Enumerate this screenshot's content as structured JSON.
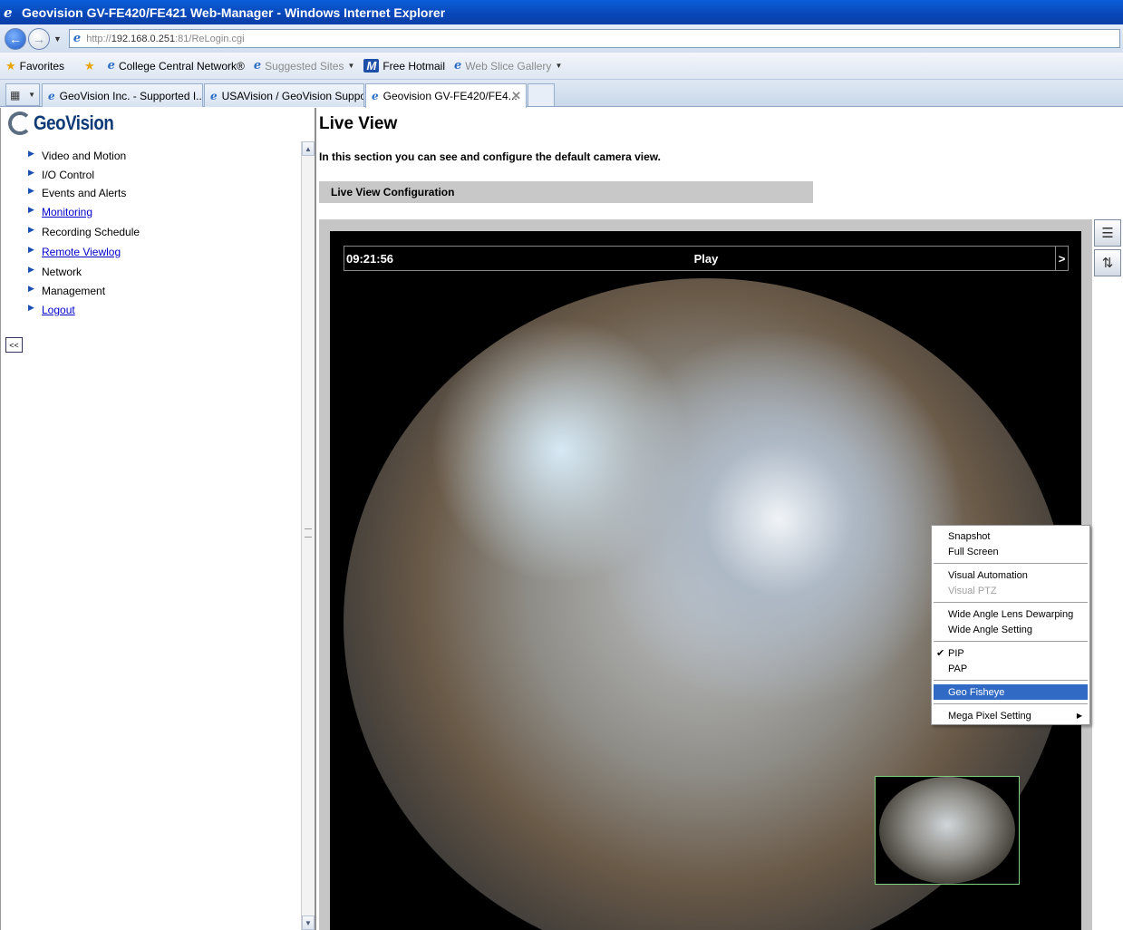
{
  "window": {
    "title": "Geovision GV-FE420/FE421 Web-Manager - Windows Internet Explorer"
  },
  "address": {
    "url_prefix": "http://",
    "url_host": "192.168.0.251",
    "url_rest": ":81/ReLogin.cgi"
  },
  "favorites": {
    "label": "Favorites",
    "items": [
      {
        "label": "College Central Network®"
      },
      {
        "label": "Suggested Sites"
      },
      {
        "label": "Free Hotmail"
      },
      {
        "label": "Web Slice Gallery"
      }
    ]
  },
  "tabs": [
    {
      "label": "GeoVision Inc. - Supported I..."
    },
    {
      "label": "USAVision / GeoVision Suppor..."
    },
    {
      "label": "Geovision GV-FE420/FE4..."
    }
  ],
  "sidebar": {
    "logo": "GeoVision",
    "items": [
      {
        "label": "Video and Motion",
        "link": false
      },
      {
        "label": "I/O Control",
        "link": false
      },
      {
        "label": "Events and Alerts",
        "link": false
      },
      {
        "label": "Monitoring",
        "link": true
      },
      {
        "label": "Recording Schedule",
        "link": false
      },
      {
        "label": "Remote Viewlog",
        "link": true
      },
      {
        "label": "Network",
        "link": false
      },
      {
        "label": "Management",
        "link": false
      },
      {
        "label": "Logout",
        "link": true
      }
    ],
    "collapse_label": "<<"
  },
  "main": {
    "title": "Live View",
    "description": "In this section you can see and configure the default camera view.",
    "section_header": "Live View Configuration"
  },
  "viewer": {
    "time": "09:21:56",
    "play_label": "Play",
    "next_label": ">"
  },
  "context_menu": {
    "groups": [
      [
        {
          "label": "Snapshot"
        },
        {
          "label": "Full Screen"
        }
      ],
      [
        {
          "label": "Visual Automation"
        },
        {
          "label": "Visual PTZ",
          "disabled": true
        }
      ],
      [
        {
          "label": "Wide Angle Lens Dewarping"
        },
        {
          "label": "Wide Angle Setting"
        }
      ],
      [
        {
          "label": "PIP",
          "checked": true
        },
        {
          "label": "PAP"
        }
      ],
      [
        {
          "label": "Geo Fisheye",
          "selected": true
        }
      ],
      [
        {
          "label": "Mega Pixel Setting",
          "submenu": true
        }
      ]
    ]
  }
}
